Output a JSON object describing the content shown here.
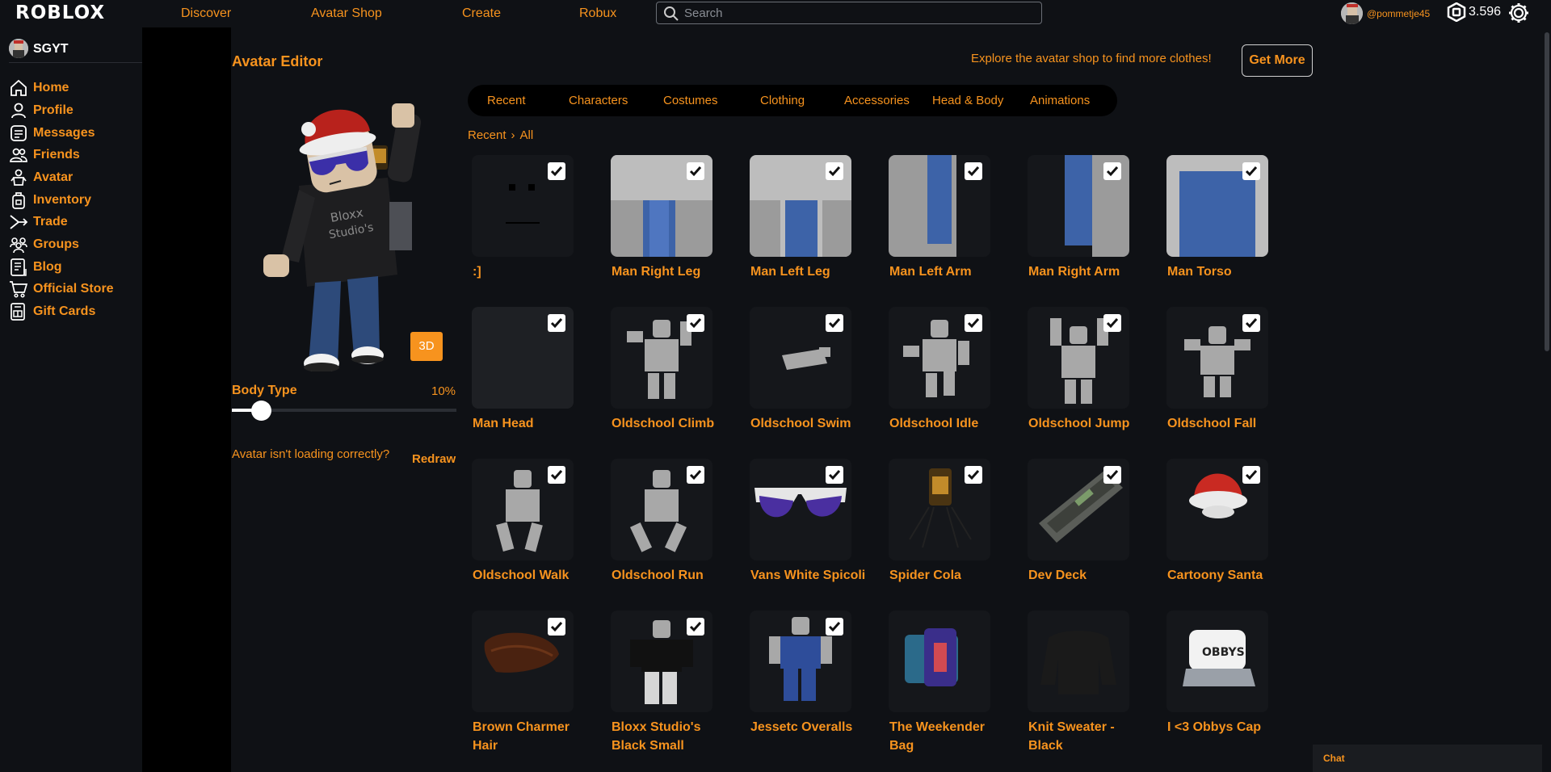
{
  "app": {
    "logo": "ROBLOX"
  },
  "topnav": {
    "discover": "Discover",
    "avatar_shop": "Avatar Shop",
    "create": "Create",
    "robux": "Robux",
    "search_placeholder": "Search",
    "username": "@pommetje45",
    "robux_count": "3.596"
  },
  "sidebar": {
    "user": "SGYT",
    "items": [
      {
        "label": "Home",
        "icon": "home-icon"
      },
      {
        "label": "Profile",
        "icon": "profile-icon"
      },
      {
        "label": "Messages",
        "icon": "messages-icon"
      },
      {
        "label": "Friends",
        "icon": "friends-icon"
      },
      {
        "label": "Avatar",
        "icon": "avatar-icon"
      },
      {
        "label": "Inventory",
        "icon": "inventory-icon"
      },
      {
        "label": "Trade",
        "icon": "trade-icon"
      },
      {
        "label": "Groups",
        "icon": "groups-icon"
      },
      {
        "label": "Blog",
        "icon": "blog-icon"
      },
      {
        "label": "Official Store",
        "icon": "store-icon"
      },
      {
        "label": "Gift Cards",
        "icon": "gift-card-icon"
      }
    ]
  },
  "editor": {
    "title": "Avatar Editor",
    "explore_text": "Explore the avatar shop to find more clothes!",
    "get_more": "Get More",
    "tabs": [
      "Recent",
      "Characters",
      "Costumes",
      "Clothing",
      "Accessories",
      "Head & Body",
      "Animations"
    ],
    "breadcrumb": {
      "parent": "Recent",
      "current": "All"
    },
    "btn_3d": "3D",
    "body_type_label": "Body Type",
    "body_type_value": "10%",
    "body_type_level": 0.1,
    "loading_text": "Avatar isn't loading correctly?",
    "redraw": "Redraw"
  },
  "items": [
    {
      "name": ":]",
      "checked": true
    },
    {
      "name": "Man Right Leg",
      "checked": true
    },
    {
      "name": "Man Left Leg",
      "checked": true
    },
    {
      "name": "Man Left Arm",
      "checked": true
    },
    {
      "name": "Man Right Arm",
      "checked": true
    },
    {
      "name": "Man Torso",
      "checked": true
    },
    {
      "name": "Man Head",
      "checked": true
    },
    {
      "name": "Oldschool Climb",
      "checked": true
    },
    {
      "name": "Oldschool Swim",
      "checked": true
    },
    {
      "name": "Oldschool Idle",
      "checked": true
    },
    {
      "name": "Oldschool Jump",
      "checked": true
    },
    {
      "name": "Oldschool Fall",
      "checked": true
    },
    {
      "name": "Oldschool Walk",
      "checked": true
    },
    {
      "name": "Oldschool Run",
      "checked": true
    },
    {
      "name": "Vans White Spicoli",
      "checked": true
    },
    {
      "name": "Spider Cola",
      "checked": true
    },
    {
      "name": "Dev Deck",
      "checked": true
    },
    {
      "name": "Cartoony Santa",
      "checked": true
    },
    {
      "name": "Brown Charmer Hair",
      "checked": true
    },
    {
      "name": "Bloxx Studio's Black Small",
      "checked": true
    },
    {
      "name": "Jessetc Overalls",
      "checked": true
    },
    {
      "name": "The Weekender Bag",
      "checked": false
    },
    {
      "name": "Knit Sweater - Black",
      "checked": false
    },
    {
      "name": "I <3 Obbys Cap",
      "checked": false
    }
  ],
  "chat": {
    "label": "Chat"
  },
  "colors": {
    "accent": "#f7931e",
    "background": "#0f1115",
    "card": "#15171b"
  }
}
